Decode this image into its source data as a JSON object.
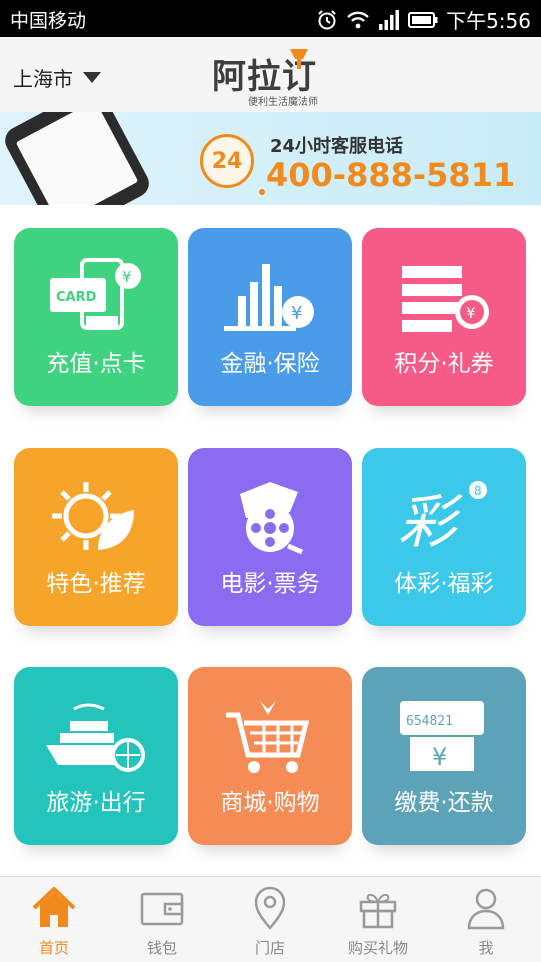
{
  "status_bar": {
    "carrier": "中国移动",
    "time": "下午5:56"
  },
  "header": {
    "city": "上海市",
    "logo_text": "阿拉订",
    "logo_sub": "便利生活魔法师"
  },
  "banner": {
    "badge": "24",
    "hotline_label": "24小时客服电话",
    "hotline_number": "400-888-5811"
  },
  "tiles": [
    {
      "label": "充值·点卡",
      "color": "#3fd27f",
      "icon": "card-recharge-icon"
    },
    {
      "label": "金融·保险",
      "color": "#4a9be8",
      "icon": "finance-chart-icon"
    },
    {
      "label": "积分·礼券",
      "color": "#f65a86",
      "icon": "points-coupon-icon"
    },
    {
      "label": "特色·推荐",
      "color": "#f7a52a",
      "icon": "sun-leaf-icon"
    },
    {
      "label": "电影·票务",
      "color": "#8a6cf0",
      "icon": "film-reel-icon"
    },
    {
      "label": "体彩·福彩",
      "color": "#3cc8e8",
      "icon": "lottery-icon"
    },
    {
      "label": "旅游·出行",
      "color": "#22c4bb",
      "icon": "ship-globe-icon"
    },
    {
      "label": "商城·购物",
      "color": "#f58b55",
      "icon": "shopping-cart-icon"
    },
    {
      "label": "缴费·还款",
      "color": "#5da3b8",
      "icon": "bill-payment-icon"
    }
  ],
  "tabbar": [
    {
      "label": "首页",
      "icon": "home-icon",
      "active": true
    },
    {
      "label": "钱包",
      "icon": "wallet-icon",
      "active": false
    },
    {
      "label": "门店",
      "icon": "location-pin-icon",
      "active": false
    },
    {
      "label": "购买礼物",
      "icon": "gift-icon",
      "active": false
    },
    {
      "label": "我",
      "icon": "user-icon",
      "active": false
    }
  ],
  "colors": {
    "accent": "#f08a1c"
  }
}
